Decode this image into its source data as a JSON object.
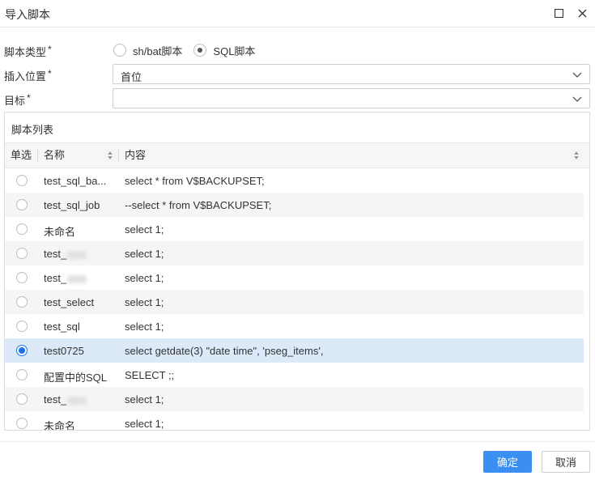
{
  "dialog": {
    "title": "导入脚本"
  },
  "form": {
    "script_type_label": "脚本类型",
    "required_mark": "*",
    "script_type_options": [
      "sh/bat脚本",
      "SQL脚本"
    ],
    "script_type_selected": "SQL脚本",
    "insert_position_label": "插入位置",
    "insert_position_value": "首位",
    "target_label": "目标",
    "target_value": ""
  },
  "script_list": {
    "title": "脚本列表",
    "columns": [
      "单选",
      "名称",
      "内容"
    ],
    "rows": [
      {
        "name": "test_sql_ba...",
        "content": "select * from V$BACKUPSET;",
        "selected": false
      },
      {
        "name": "test_sql_job",
        "content": "--select * from V$BACKUPSET;",
        "selected": false
      },
      {
        "name": "未命名",
        "content": "select 1;",
        "selected": false
      },
      {
        "name": "test_",
        "content": "select 1;",
        "selected": false,
        "redacted": true
      },
      {
        "name": "test_",
        "content": "select 1;",
        "selected": false,
        "redacted": true
      },
      {
        "name": "test_select",
        "content": "select 1;",
        "selected": false
      },
      {
        "name": "test_sql",
        "content": "select 1;",
        "selected": false
      },
      {
        "name": "test0725",
        "content": "select getdate(3) \"date time\", 'pseg_items',",
        "selected": true
      },
      {
        "name": "配置中的SQL",
        "content": "SELECT ;;",
        "selected": false
      },
      {
        "name": "test_",
        "content": "select 1;",
        "selected": false,
        "redacted": true
      },
      {
        "name": "未命名",
        "content": "select 1;",
        "selected": false
      }
    ]
  },
  "footer": {
    "ok_label": "确定",
    "cancel_label": "取消"
  },
  "colors": {
    "primary": "#3b8ff0",
    "selected_row": "#dce9f9",
    "radio_selected": "#1a73e8"
  }
}
